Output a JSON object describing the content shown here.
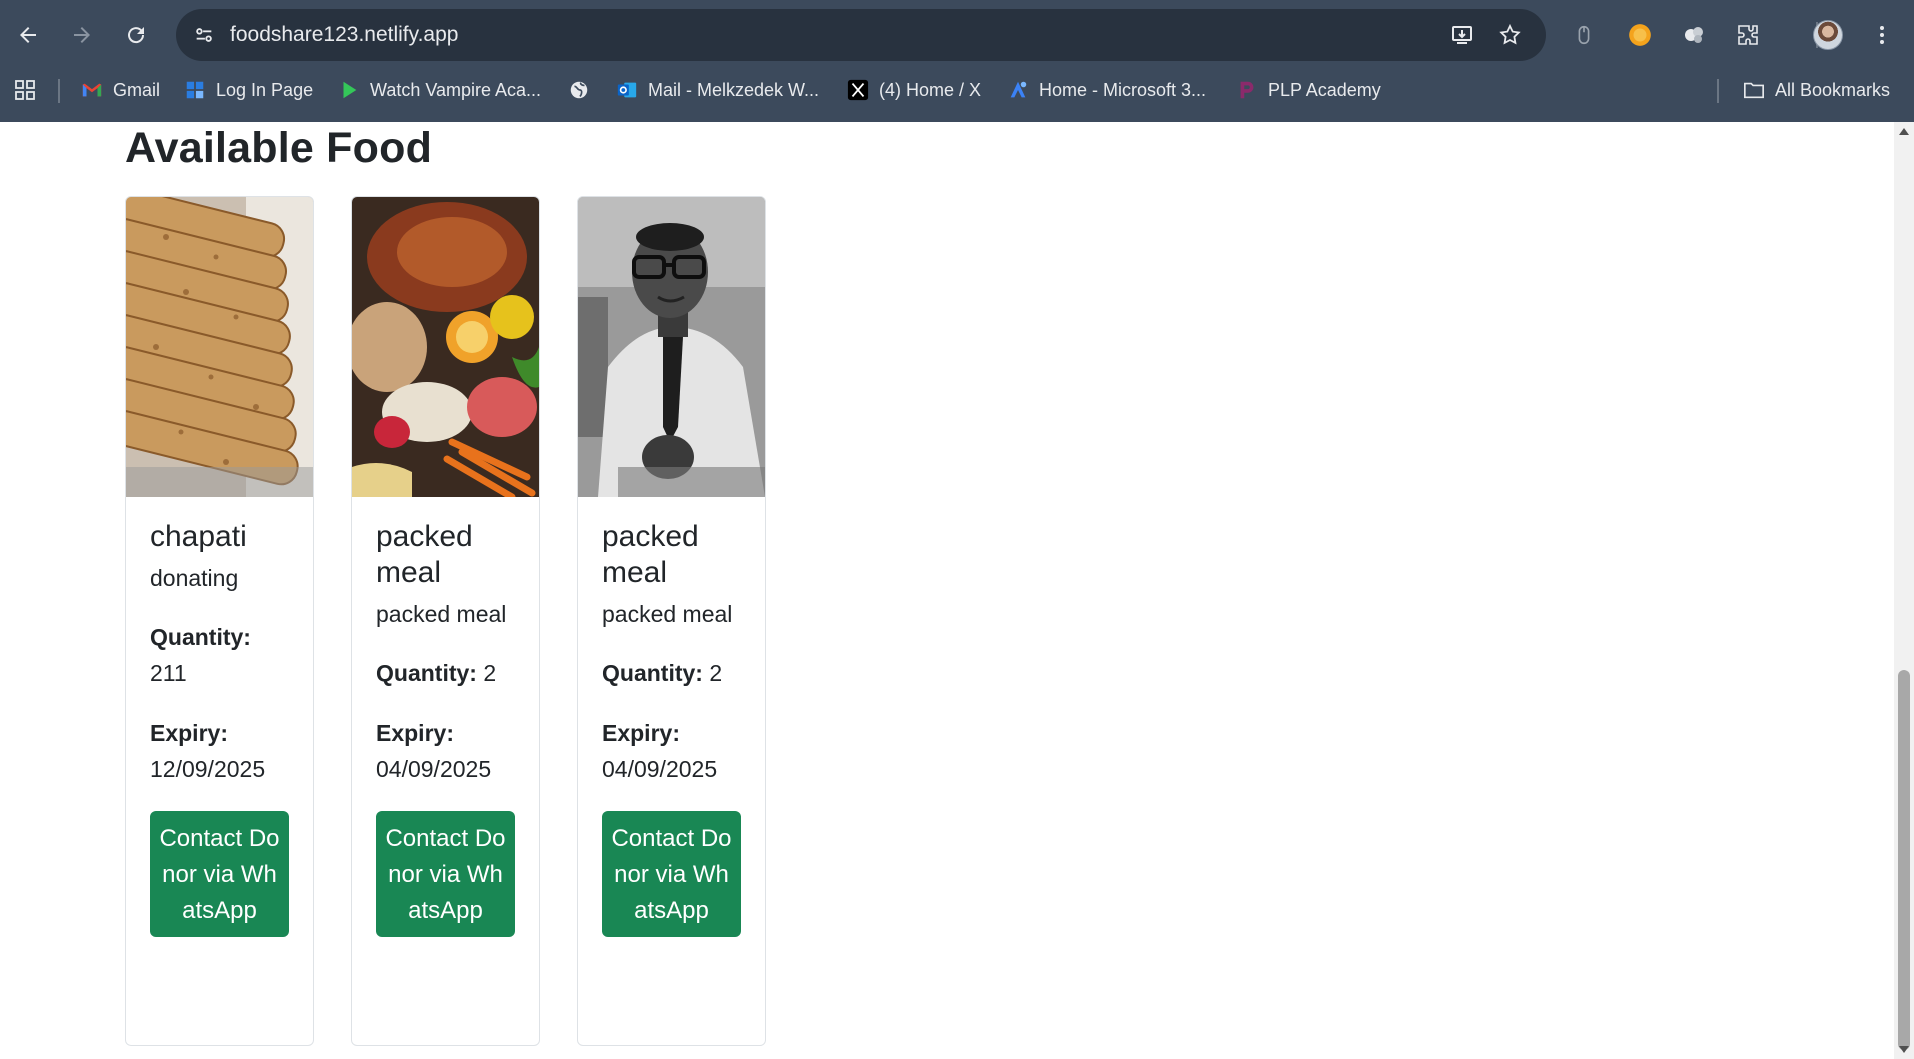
{
  "browser": {
    "url": "foodshare123.netlify.app",
    "bookmarks": [
      {
        "label": "Gmail",
        "icon": "gmail-icon"
      },
      {
        "label": "Log In Page",
        "icon": "page-icon"
      },
      {
        "label": "Watch Vampire Aca...",
        "icon": "play-icon"
      },
      {
        "label": "",
        "icon": "globe-icon"
      },
      {
        "label": "Mail - Melkzedek W...",
        "icon": "outlook-icon"
      },
      {
        "label": "(4) Home / X",
        "icon": "x-icon"
      },
      {
        "label": "Home - Microsoft 3...",
        "icon": "microsoft-icon"
      },
      {
        "label": "PLP Academy",
        "icon": "plp-icon"
      }
    ],
    "all_bookmarks_label": "All Bookmarks"
  },
  "page": {
    "title": "Available Food",
    "cards": [
      {
        "title": "chapati",
        "description": "donating",
        "quantity_label": "Quantity:",
        "quantity": "211",
        "expiry_label": "Expiry:",
        "expiry": "12/09/2025",
        "button_label": "Contact Donor via WhatsApp",
        "image": "chapati-photo"
      },
      {
        "title": "packed meal",
        "description": "packed meal",
        "quantity_label": "Quantity:",
        "quantity": "2",
        "expiry_label": "Expiry:",
        "expiry": "04/09/2025",
        "button_label": "Contact Donor via WhatsApp",
        "image": "assorted-food-photo"
      },
      {
        "title": "packed meal",
        "description": "packed meal",
        "quantity_label": "Quantity:",
        "quantity": "2",
        "expiry_label": "Expiry:",
        "expiry": "04/09/2025",
        "button_label": "Contact Donor via WhatsApp",
        "image": "person-portrait-photo"
      }
    ]
  },
  "colors": {
    "chrome_bg": "#3c4a5c",
    "omnibox_bg": "#28323f",
    "button_green": "#198754",
    "text_dark": "#212529"
  }
}
